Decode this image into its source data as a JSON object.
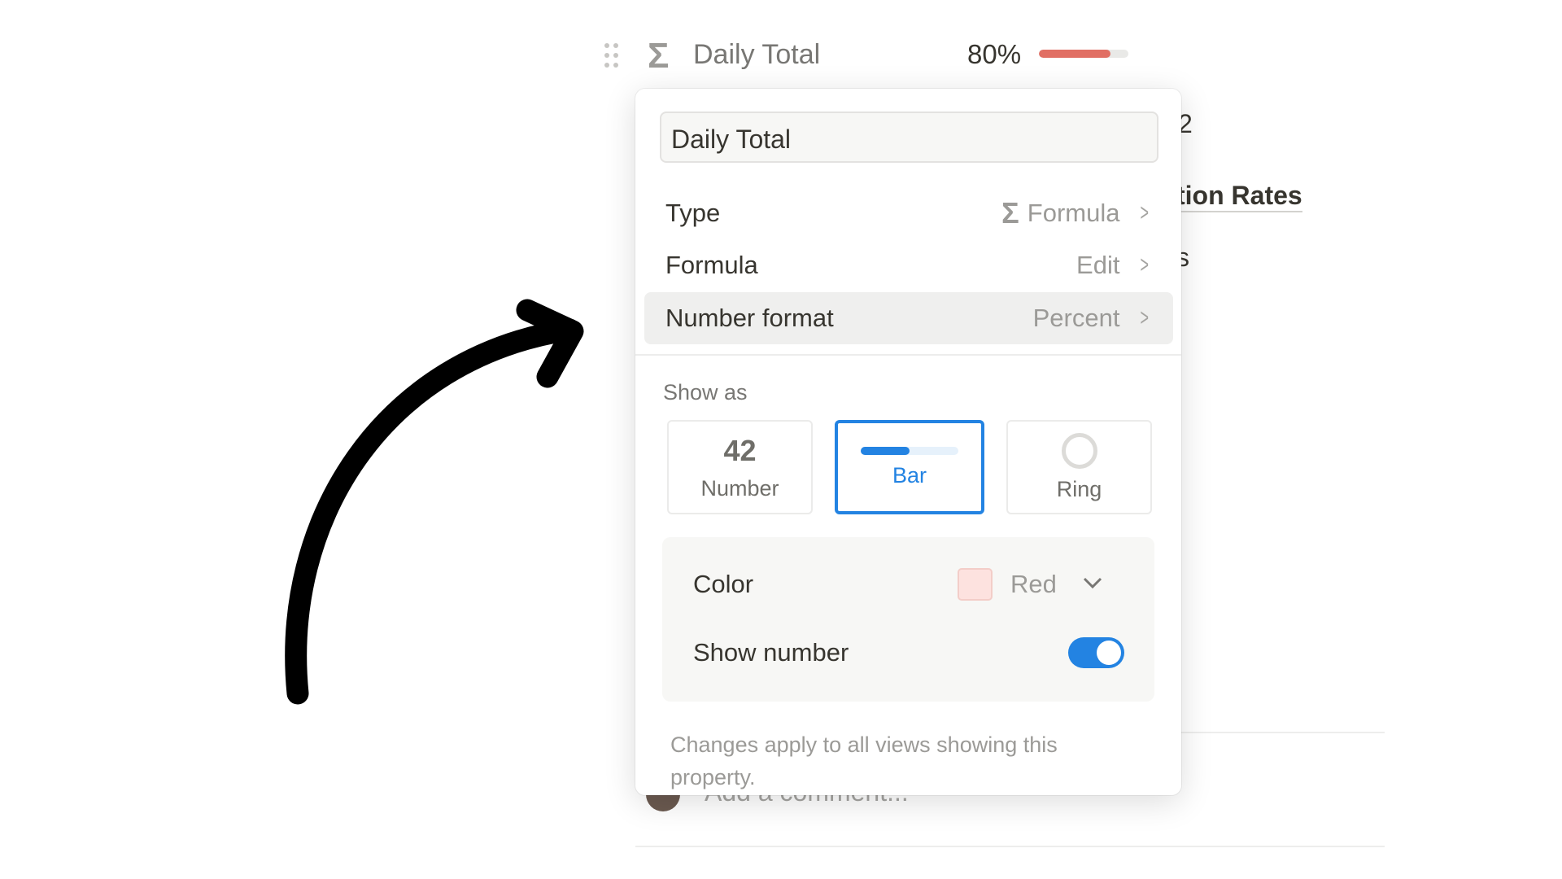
{
  "property_header": {
    "icon": "sigma-icon",
    "name": "Daily Total",
    "value": "80%",
    "progress_percent": 80,
    "bar_color": "#e16f64"
  },
  "background": {
    "fragment_1": "2",
    "fragment_2": "tion Rates",
    "fragment_3": "s",
    "comment_placeholder": "Add a comment..."
  },
  "popup": {
    "name_value": "Daily Total",
    "rows": [
      {
        "label": "Type",
        "value": "Formula",
        "icon": "sigma-icon"
      },
      {
        "label": "Formula",
        "value": "Edit"
      },
      {
        "label": "Number format",
        "value": "Percent"
      }
    ],
    "show_as_label": "Show as",
    "show_as_options": [
      {
        "preview": "42",
        "label": "Number"
      },
      {
        "label": "Bar",
        "selected": true
      },
      {
        "label": "Ring"
      }
    ],
    "color_label": "Color",
    "color_value": "Red",
    "color_swatch": "#fde2df",
    "show_number_label": "Show number",
    "show_number_on": true,
    "accent": "#2383e2",
    "footer": "Changes apply to all views showing this property."
  }
}
